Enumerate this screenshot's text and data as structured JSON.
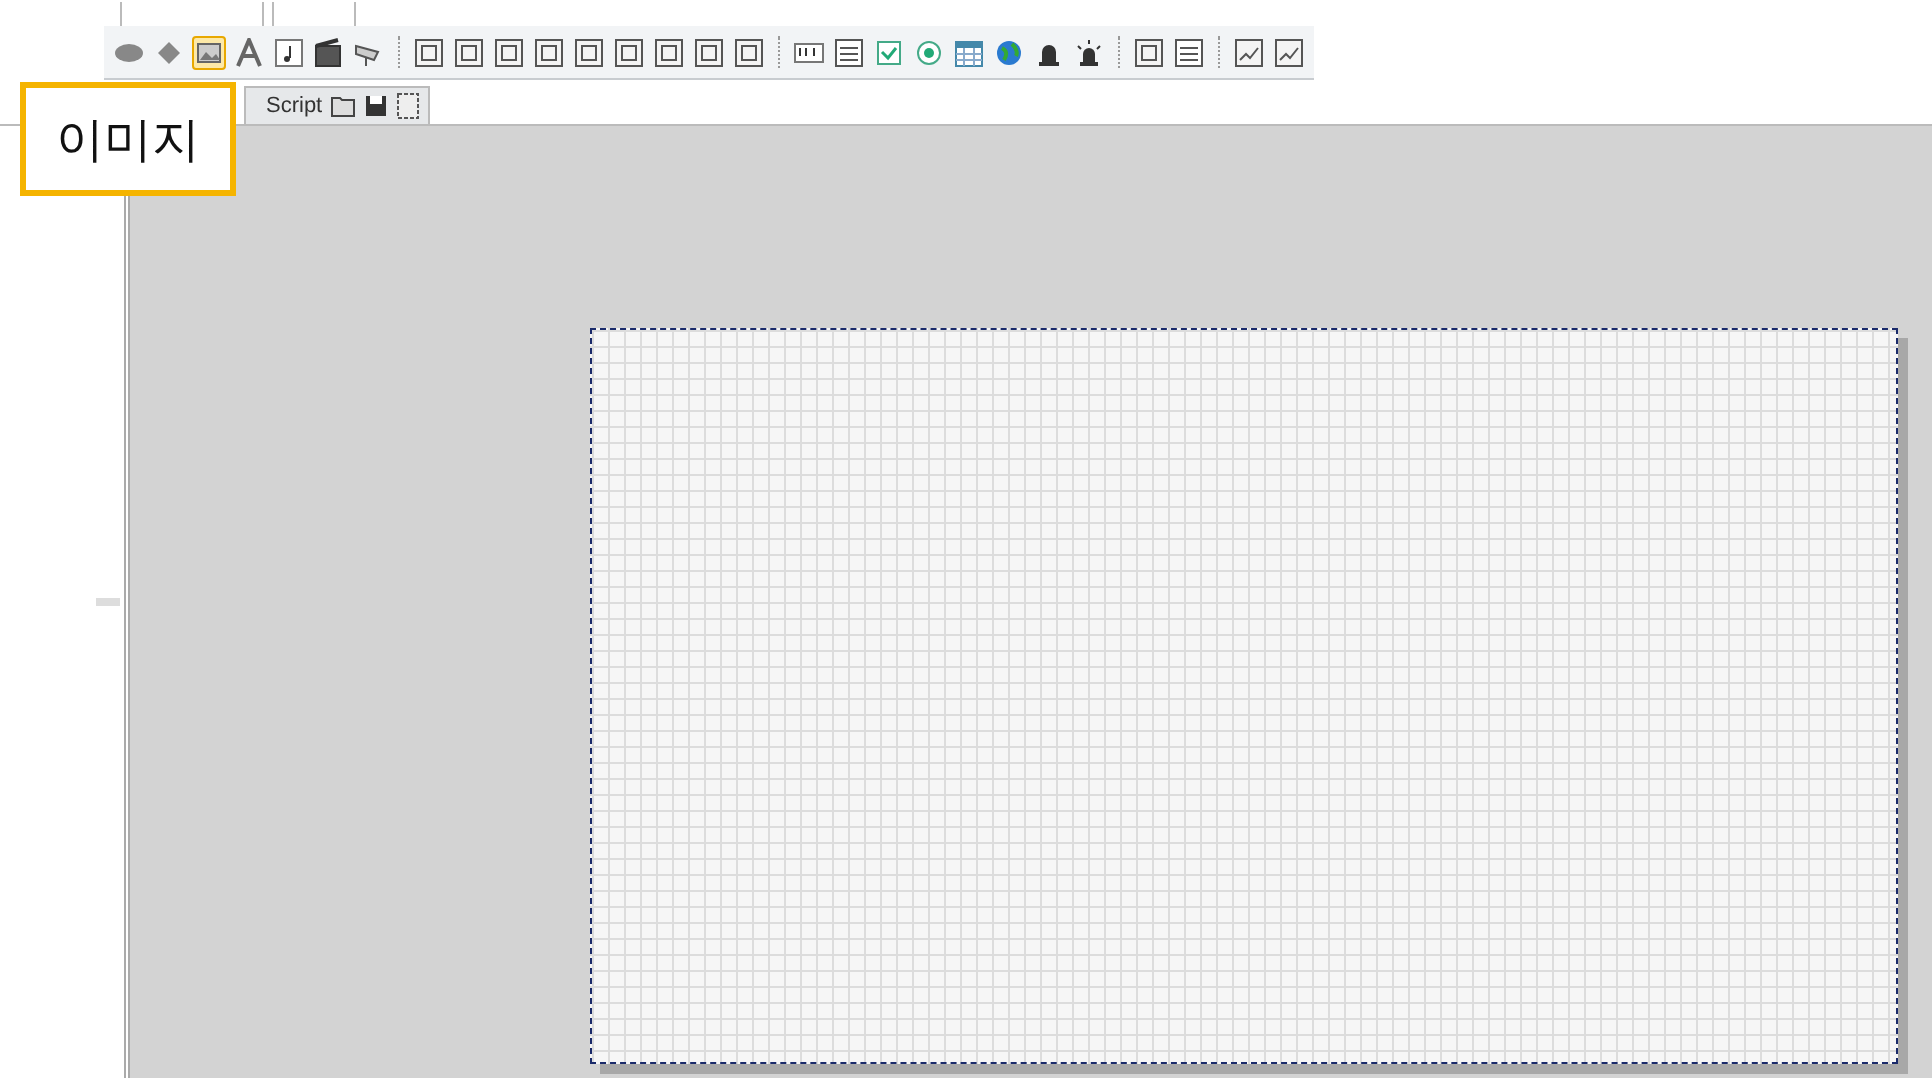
{
  "toolbar": {
    "groups": [
      {
        "tools": [
          {
            "kind": "ellipse",
            "selected": false
          },
          {
            "kind": "diamond",
            "selected": false
          },
          {
            "kind": "image",
            "selected": true
          },
          {
            "kind": "letter",
            "selected": false
          },
          {
            "kind": "note",
            "selected": false
          },
          {
            "kind": "film",
            "selected": false
          },
          {
            "kind": "camera",
            "selected": false
          }
        ]
      },
      {
        "tools": [
          {
            "kind": "frame",
            "selected": false
          },
          {
            "kind": "frame",
            "selected": false
          },
          {
            "kind": "frame",
            "selected": false
          },
          {
            "kind": "frame",
            "selected": false
          },
          {
            "kind": "frame",
            "selected": false
          },
          {
            "kind": "frame",
            "selected": false
          },
          {
            "kind": "frame",
            "selected": false
          },
          {
            "kind": "frame",
            "selected": false
          },
          {
            "kind": "frame",
            "selected": false
          }
        ]
      },
      {
        "tools": [
          {
            "kind": "textbox",
            "selected": false
          },
          {
            "kind": "list",
            "selected": false
          },
          {
            "kind": "checkbox",
            "selected": false
          },
          {
            "kind": "radio",
            "selected": false
          },
          {
            "kind": "table",
            "selected": false
          },
          {
            "kind": "globe",
            "selected": false
          },
          {
            "kind": "bell",
            "selected": false
          },
          {
            "kind": "alarm",
            "selected": false
          }
        ]
      },
      {
        "tools": [
          {
            "kind": "frame",
            "selected": false
          },
          {
            "kind": "list",
            "selected": false
          }
        ]
      },
      {
        "tools": [
          {
            "kind": "trend",
            "selected": false
          },
          {
            "kind": "trend",
            "selected": false
          }
        ]
      }
    ]
  },
  "tabs": [
    {
      "label": "Script",
      "selected": true
    }
  ],
  "callout": {
    "label": "이미지"
  }
}
